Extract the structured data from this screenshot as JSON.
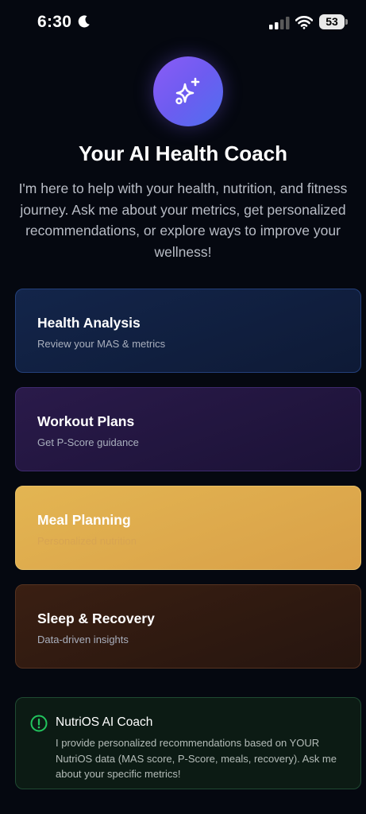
{
  "status_bar": {
    "time": "6:30",
    "battery_level": "53",
    "icons": [
      "moon-icon",
      "signal-icon",
      "wifi-icon",
      "battery-icon"
    ]
  },
  "hero": {
    "icon": "sparkles-icon",
    "title": "Your AI Health Coach",
    "subtitle": "I'm here to help with your health, nutrition, and fitness journey. Ask me about your metrics, get personalized recommendations, or explore ways to improve your wellness!"
  },
  "cards": [
    {
      "title": "Health Analysis",
      "subtitle": "Review your MAS & metrics",
      "color": "#13254a"
    },
    {
      "title": "Workout Plans",
      "subtitle": "Get P-Score guidance",
      "color": "#2a1a4a"
    },
    {
      "title": "Meal Planning",
      "subtitle": "Personalized nutrition",
      "color": "#e3b552"
    },
    {
      "title": "Sleep & Recovery",
      "subtitle": "Data-driven insights",
      "color": "#3a1f12"
    }
  ],
  "info": {
    "icon": "alert-circle-icon",
    "title": "NutriOS AI Coach",
    "text": "I provide personalized recommendations based on YOUR NutriOS data (MAS score, P-Score, meals, recovery). Ask me about your specific metrics!",
    "accent": "#22c55e"
  }
}
